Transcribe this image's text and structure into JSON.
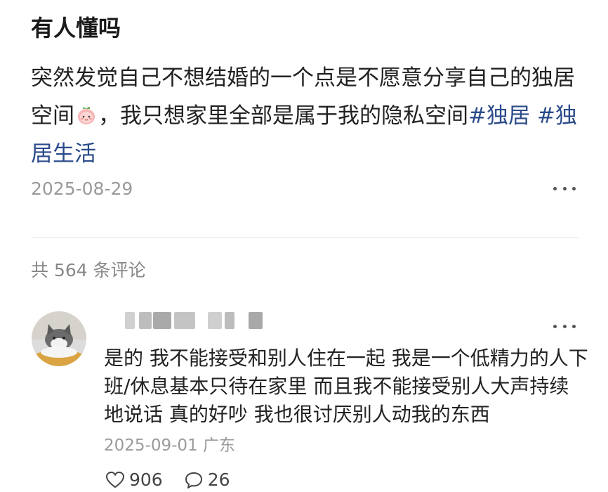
{
  "post": {
    "title": "有人懂吗",
    "body_text_1": "突然发觉自己不想结婚的一个点是不愿意分享自己的独居空间",
    "body_text_2": "，我只想家里全部是属于我的隐私空间",
    "hashtag_1": "#独居",
    "hashtag_2": "#独居生活",
    "date": "2025-08-29",
    "emoji_icon": "peach-face-icon"
  },
  "comments_section": {
    "count_label": "共 564 条评论"
  },
  "comment": {
    "text": "是的 我不能接受和别人住在一起 我是一个低精力的人下班/休息基本只待在家里 而且我不能接受别人大声持续地说话 真的好吵 我也很讨厌别人动我的东西",
    "date": "2025-09-01",
    "location": "广东",
    "likes": "906",
    "replies": "26"
  },
  "colors": {
    "hashtag": "#2b4b8a",
    "muted_text": "#9a9a9a"
  }
}
